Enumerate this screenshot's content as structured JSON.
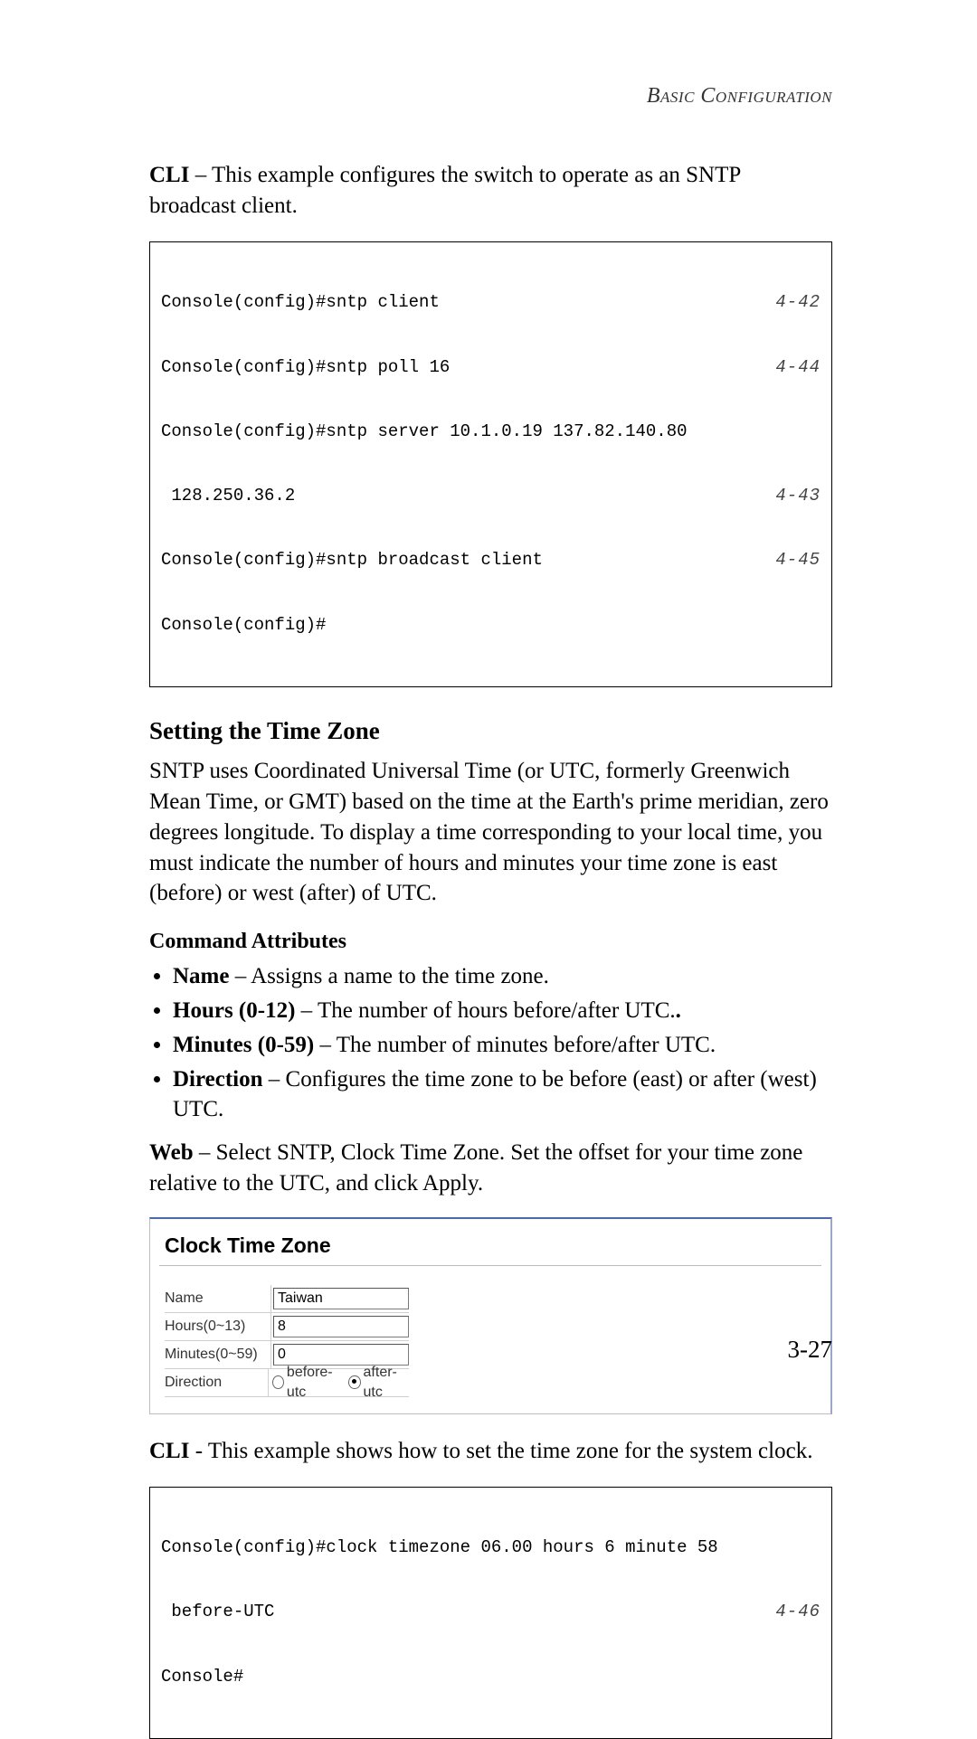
{
  "running_head": "Basic Configuration",
  "intro": {
    "label_cli": "CLI",
    "intro_text": " – This example configures the switch to operate as an SNTP broadcast client."
  },
  "cli1": {
    "lines": [
      {
        "cmd": "Console(config)#sntp client",
        "ref": "4-42"
      },
      {
        "cmd": "Console(config)#sntp poll 16",
        "ref": "4-44"
      },
      {
        "cmd": "Console(config)#sntp server 10.1.0.19 137.82.140.80",
        "ref": ""
      },
      {
        "cmd": " 128.250.36.2",
        "ref": "4-43"
      },
      {
        "cmd": "Console(config)#sntp broadcast client",
        "ref": "4-45"
      },
      {
        "cmd": "Console(config)#",
        "ref": ""
      }
    ]
  },
  "section_title": "Setting the Time Zone",
  "section_body": "SNTP uses Coordinated Universal Time (or UTC, formerly Greenwich Mean Time, or GMT) based on the time at the Earth's prime meridian, zero degrees longitude. To display a time corresponding to your local time, you must indicate the number of hours and minutes your time zone is east (before) or west (after) of UTC.",
  "attrs_heading": "Command Attributes",
  "attrs": [
    {
      "name": "Name",
      "desc": " – Assigns a name to the time zone."
    },
    {
      "name": "Hours (0-12)",
      "desc": " – The number of hours before/after UTC."
    },
    {
      "name": "Minutes (0-59)",
      "desc": " – The number of minutes before/after UTC."
    },
    {
      "name": "Direction",
      "desc": " – Configures the time zone to be before (east) or after (west) UTC."
    }
  ],
  "web_intro": {
    "label": "Web",
    "text": " – Select SNTP, Clock Time Zone. Set the offset for your time zone relative to the UTC, and click Apply."
  },
  "web_ui": {
    "title": "Clock Time Zone",
    "rows": {
      "name": {
        "label": "Name",
        "value": "Taiwan"
      },
      "hours": {
        "label": "Hours(0~13)",
        "value": "8"
      },
      "minutes": {
        "label": "Minutes(0~59)",
        "value": "0"
      },
      "direction": {
        "label": "Direction",
        "options": [
          {
            "label": "before-utc",
            "checked": false
          },
          {
            "label": "after-utc",
            "checked": true
          }
        ]
      }
    }
  },
  "cli2_intro": {
    "label": "CLI",
    "text": " - This example shows how to set the time zone for the system clock."
  },
  "cli2": {
    "lines": [
      {
        "cmd": "Console(config)#clock timezone 06.00 hours 6 minute 58",
        "ref": ""
      },
      {
        "cmd": " before-UTC",
        "ref": "4-46"
      },
      {
        "cmd": "Console#",
        "ref": ""
      }
    ]
  },
  "page_number": "3-27"
}
